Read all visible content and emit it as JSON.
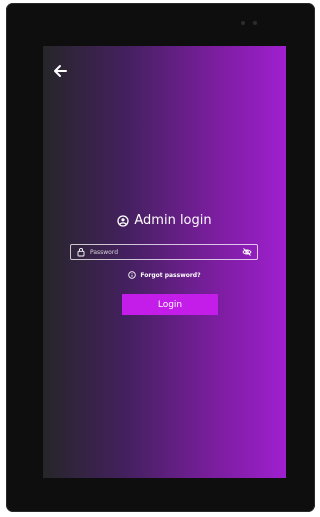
{
  "screen": {
    "title": "Admin login",
    "password": {
      "placeholder": "Password",
      "value": ""
    },
    "forgot_password": "Forgot password?",
    "login_button": "Login"
  },
  "icons": {
    "back": "arrow-left-icon",
    "title": "user-circle-icon",
    "lock": "lock-icon",
    "visibility": "eye-off-icon",
    "info": "info-circle-icon"
  },
  "colors": {
    "gradient_start": "#262629",
    "gradient_end": "#a01fcf",
    "button": "#c41ce9",
    "text": "#ffffff"
  }
}
